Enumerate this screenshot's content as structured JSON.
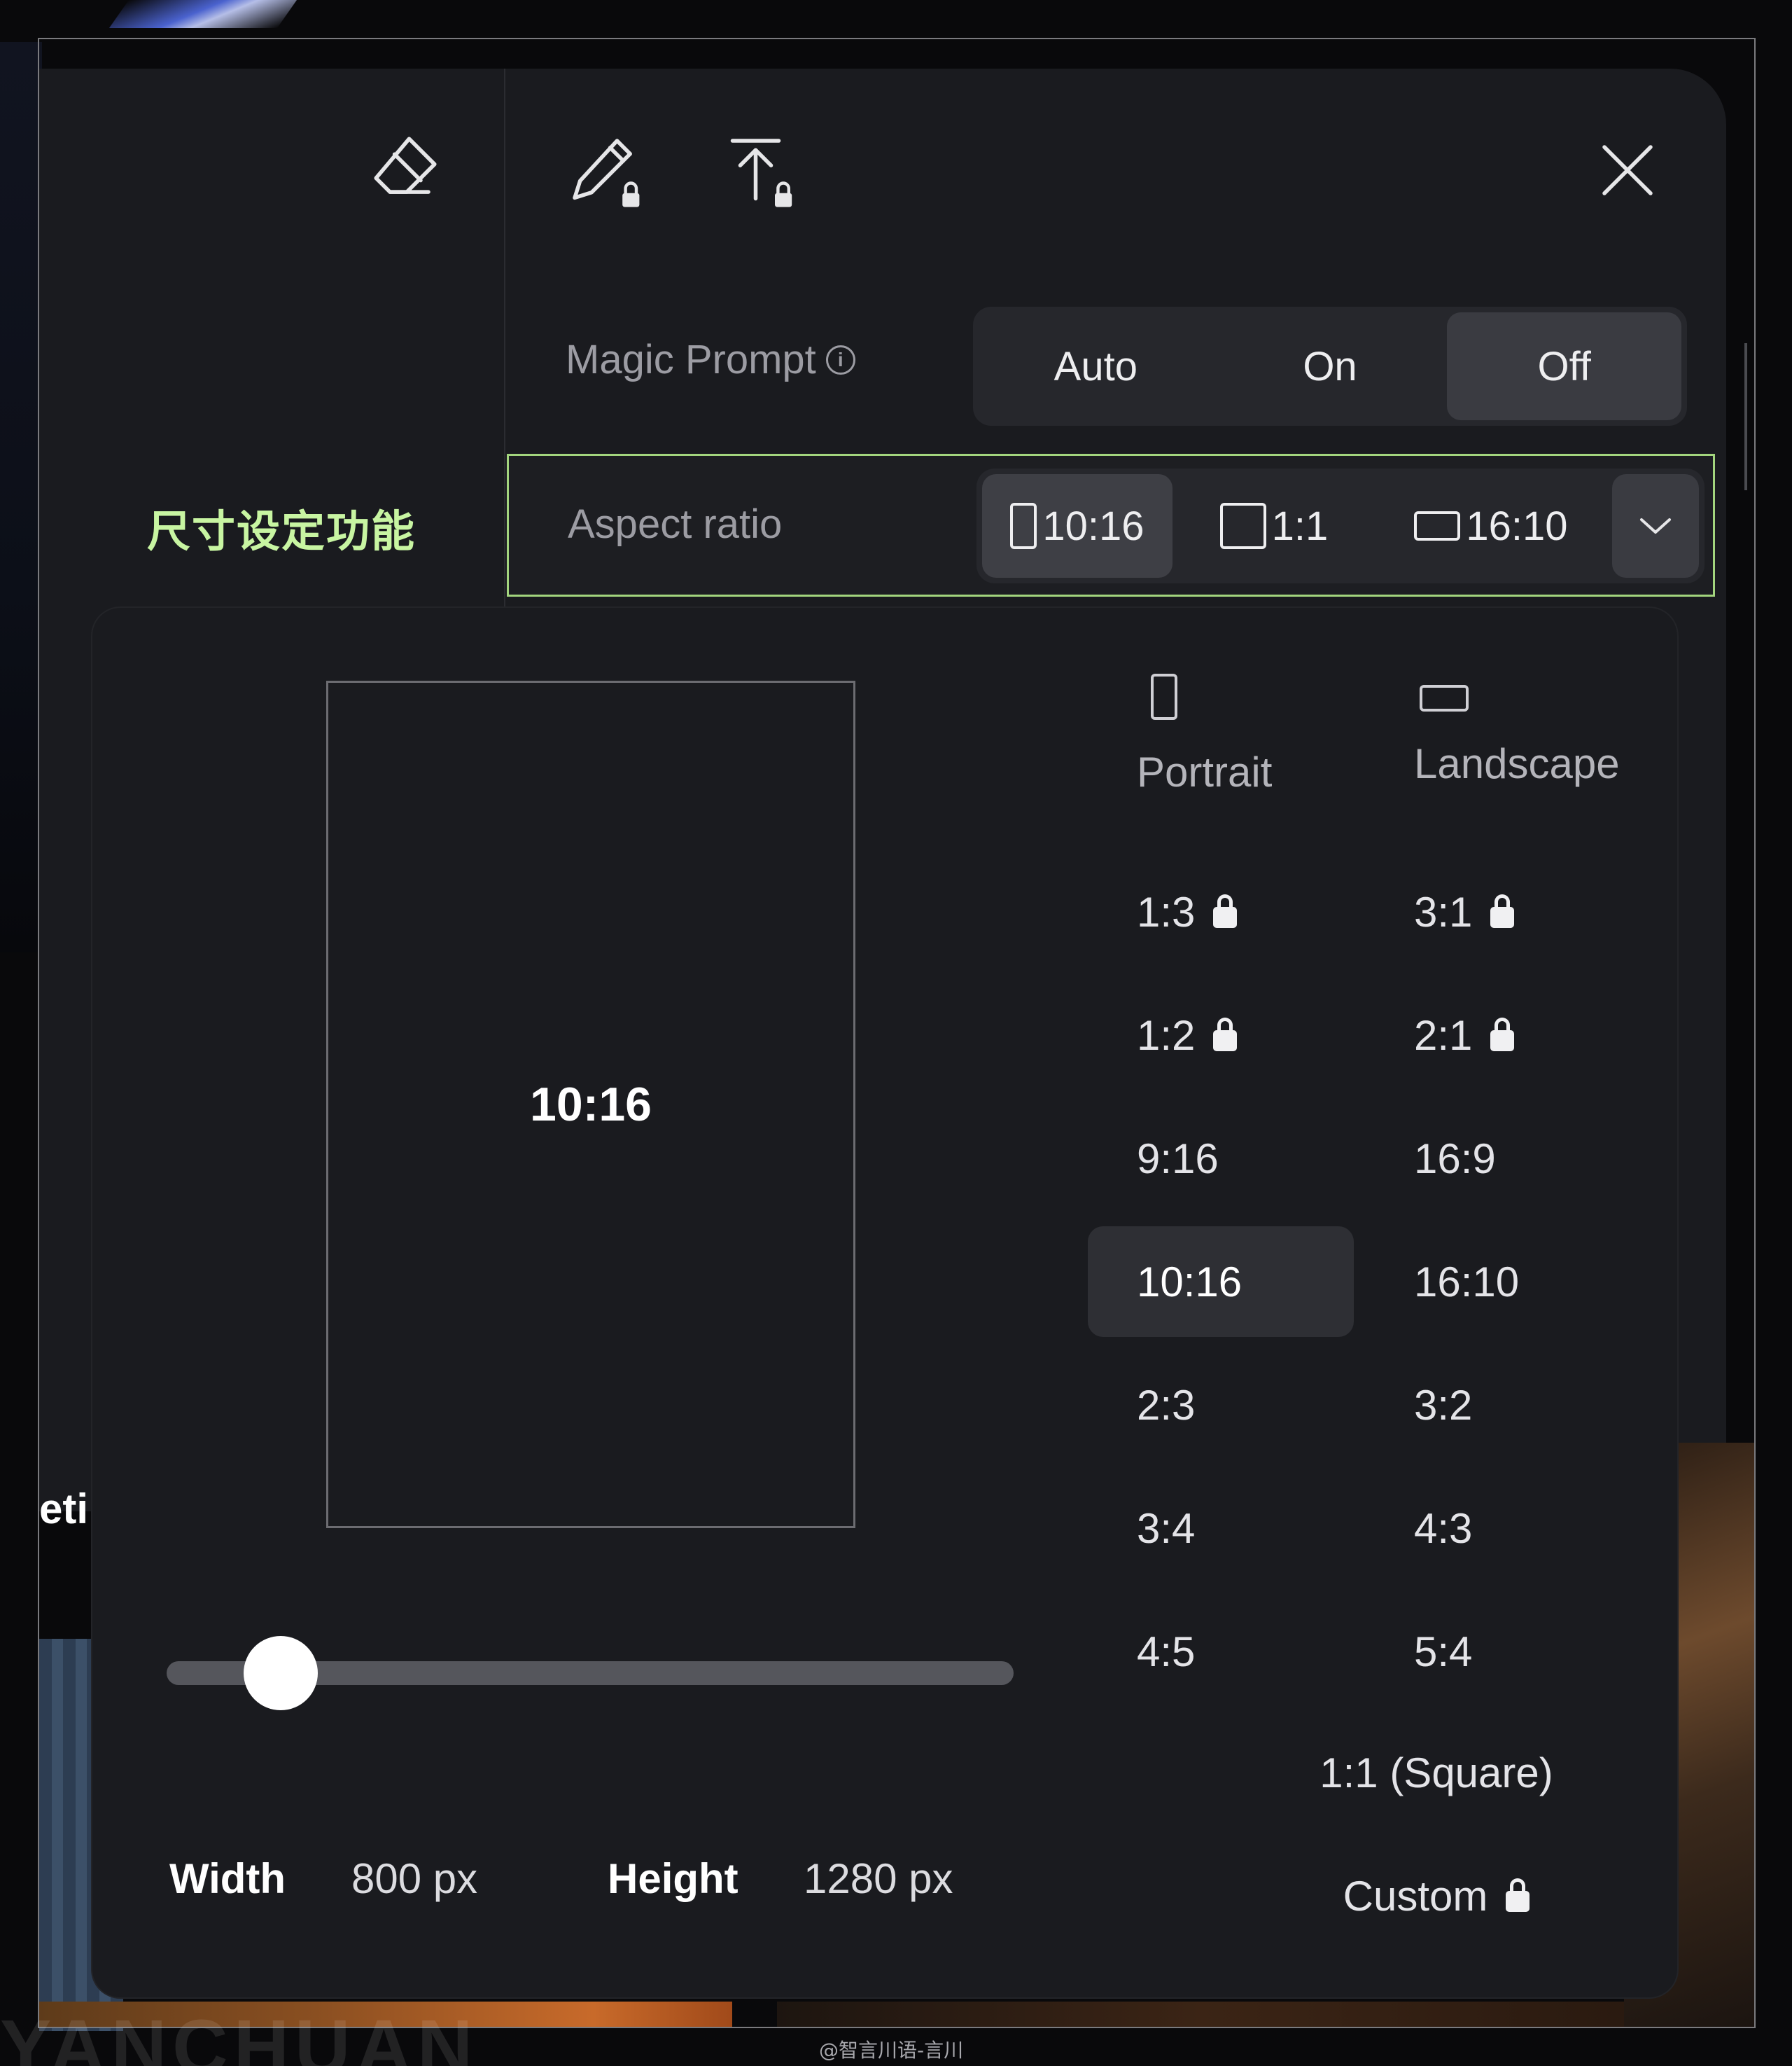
{
  "toolbar": {
    "eraser_icon": "eraser-icon",
    "edit_icon": "pencil-locked-icon",
    "upload_icon": "upload-locked-icon",
    "close_icon": "close-icon"
  },
  "magic_prompt": {
    "label": "Magic Prompt",
    "info_glyph": "i",
    "options": [
      "Auto",
      "On",
      "Off"
    ],
    "selected": "Off"
  },
  "annotation": "尺寸设定功能",
  "aspect_ratio": {
    "label": "Aspect ratio",
    "quick_options": [
      "10:16",
      "1:1",
      "16:10"
    ],
    "selected": "10:16"
  },
  "popover": {
    "preview_label": "10:16",
    "slider_value": 0.1,
    "width_label": "Width",
    "width_value": "800 px",
    "height_label": "Height",
    "height_value": "1280 px",
    "portrait_header": "Portrait",
    "landscape_header": "Landscape",
    "portrait_ratios": [
      {
        "label": "1:3",
        "locked": true
      },
      {
        "label": "1:2",
        "locked": true
      },
      {
        "label": "9:16",
        "locked": false
      },
      {
        "label": "10:16",
        "locked": false
      },
      {
        "label": "2:3",
        "locked": false
      },
      {
        "label": "3:4",
        "locked": false
      },
      {
        "label": "4:5",
        "locked": false
      }
    ],
    "landscape_ratios": [
      {
        "label": "3:1",
        "locked": true
      },
      {
        "label": "2:1",
        "locked": true
      },
      {
        "label": "16:9",
        "locked": false
      },
      {
        "label": "16:10",
        "locked": false
      },
      {
        "label": "3:2",
        "locked": false
      },
      {
        "label": "4:3",
        "locked": false
      },
      {
        "label": "5:4",
        "locked": false
      }
    ],
    "square_label": "1:1 (Square)",
    "custom_label": "Custom",
    "selected_ratio": "10:16"
  },
  "background": {
    "partial_text": "eti",
    "watermark": "YANCHUAN",
    "credit": "@智言川语-言川"
  },
  "colors": {
    "highlight_border": "#a3d57e",
    "annotation_text": "#c8f5a2",
    "panel_bg": "#1a1b1f",
    "selected_bg": "#3a3b41"
  }
}
